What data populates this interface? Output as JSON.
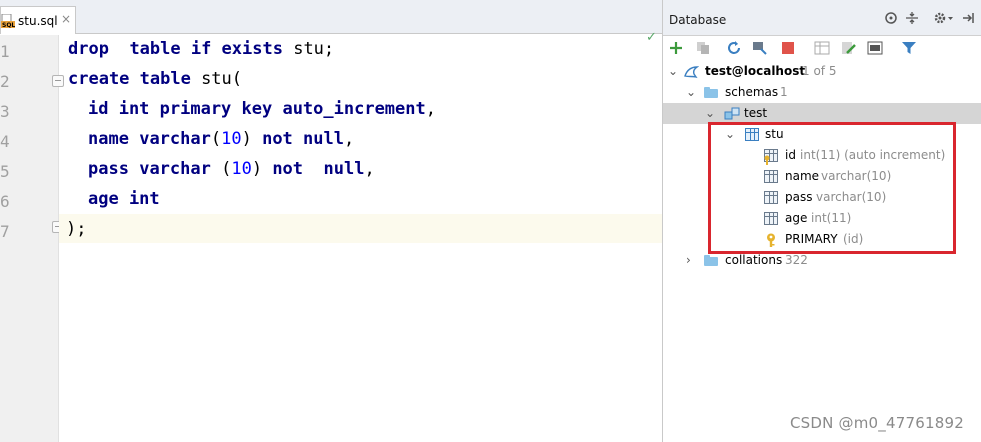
{
  "editor": {
    "tab": {
      "file_name": "stu.sql",
      "close_glyph": "×",
      "icon": "sql-file-icon"
    },
    "line_numbers": [
      "1",
      "2",
      "3",
      "4",
      "5",
      "6",
      "7"
    ],
    "inspection_glyph": "✓",
    "code": {
      "l1": {
        "kw1": "drop",
        "kw2": "table if exists",
        "rest": " stu;"
      },
      "l2": {
        "kw": "create table",
        "rest": " stu("
      },
      "l3": {
        "kw": "id int primary key auto_increment",
        "punct": ","
      },
      "l4": {
        "kw1": "name",
        "kw2": "varchar",
        "open": "(",
        "num": "10",
        "close": ") ",
        "kw3": "not null",
        "punct": ","
      },
      "l5": {
        "kw1": "pass",
        "kw2": "varchar",
        "open": " (",
        "num": "10",
        "close": ") ",
        "kw3": "not  null",
        "punct": ","
      },
      "l6": {
        "kw": "age int"
      },
      "l7": {
        "text": ");"
      }
    }
  },
  "database": {
    "title": "Database",
    "tree": {
      "connection": {
        "label": "test@localhost",
        "hint": "1 of 5"
      },
      "schemas": {
        "label": "schemas",
        "hint": "1"
      },
      "schema_test": {
        "label": "test"
      },
      "table_stu": {
        "label": "stu"
      },
      "columns": [
        {
          "name": "id",
          "type": "int(11) (auto increment)"
        },
        {
          "name": "name",
          "type": "varchar(10)"
        },
        {
          "name": "pass",
          "type": "varchar(10)"
        },
        {
          "name": "age",
          "type": "int(11)"
        }
      ],
      "primary_key": {
        "name": "PRIMARY",
        "hint": "(id)"
      },
      "collations": {
        "label": "collations",
        "hint": "322"
      }
    },
    "colors": {
      "highlight": "#d9262e",
      "keyword": "#000080",
      "number": "#0000ff"
    }
  },
  "watermark": "CSDN @m0_47761892"
}
